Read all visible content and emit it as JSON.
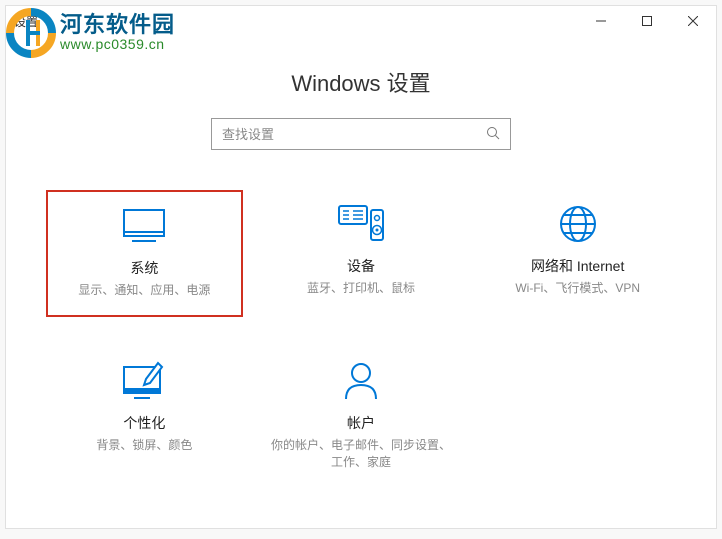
{
  "window": {
    "title": "设置"
  },
  "watermark": {
    "name": "河东软件园",
    "url": "www.pc0359.cn"
  },
  "page": {
    "title": "Windows 设置",
    "search_placeholder": "查找设置"
  },
  "tiles": [
    {
      "id": "system",
      "title": "系统",
      "desc": "显示、通知、应用、电源",
      "highlighted": true
    },
    {
      "id": "devices",
      "title": "设备",
      "desc": "蓝牙、打印机、鼠标",
      "highlighted": false
    },
    {
      "id": "network",
      "title": "网络和 Internet",
      "desc": "Wi-Fi、飞行模式、VPN",
      "highlighted": false
    },
    {
      "id": "personalization",
      "title": "个性化",
      "desc": "背景、锁屏、颜色",
      "highlighted": false
    },
    {
      "id": "accounts",
      "title": "帐户",
      "desc": "你的帐户、电子邮件、同步设置、工作、家庭",
      "highlighted": false
    }
  ]
}
